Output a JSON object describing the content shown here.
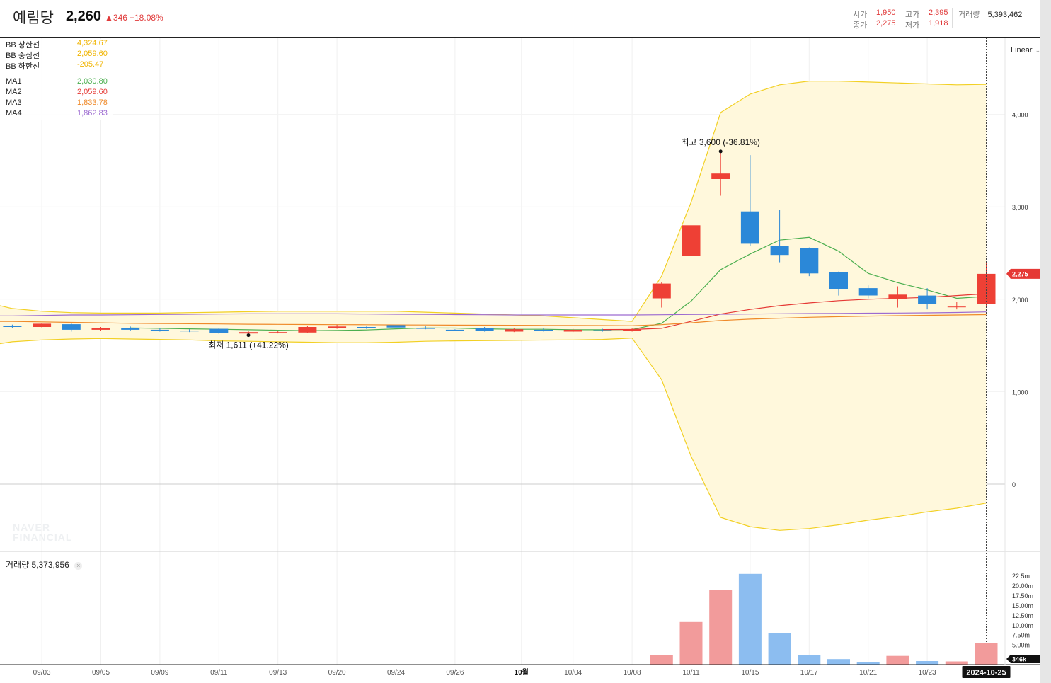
{
  "header": {
    "name": "예림당",
    "price": "2,260",
    "change": "346",
    "change_pct": "+18.08%",
    "ohlc": [
      {
        "label": "시가",
        "value": "1,950"
      },
      {
        "label": "고가",
        "value": "2,395"
      },
      {
        "label": "종가",
        "value": "2,275"
      },
      {
        "label": "저가",
        "value": "1,918"
      }
    ],
    "volume_label": "거래량",
    "volume_value": "5,393,462"
  },
  "legend": {
    "bb": [
      {
        "label": "BB 상한선",
        "value": "4,324.67",
        "color": "#f0b400"
      },
      {
        "label": "BB 중심선",
        "value": "2,059.60",
        "color": "#f0b400"
      },
      {
        "label": "BB 하한선",
        "value": "-205.47",
        "color": "#f0b400"
      }
    ],
    "ma": [
      {
        "label": "MA1",
        "value": "2,030.80",
        "color": "#4caf50"
      },
      {
        "label": "MA2",
        "value": "2,059.60",
        "color": "#e53935"
      },
      {
        "label": "MA3",
        "value": "1,833.78",
        "color": "#ef8a2a"
      },
      {
        "label": "MA4",
        "value": "1,862.83",
        "color": "#9c6ad0"
      }
    ]
  },
  "scale_mode": "Linear",
  "volume_panel": {
    "label": "거래량",
    "value": "5,373,956"
  },
  "watermark": [
    "NAVER",
    "FINANCIAL"
  ],
  "chart_data": {
    "type": "candlestick",
    "price_axis": {
      "min": -300,
      "max": 4600,
      "ticks": [
        0,
        1000,
        2000,
        3000,
        4000
      ],
      "tick_labels": [
        "0",
        "1,000",
        "2,000",
        "3,000",
        "4,000"
      ]
    },
    "volume_axis": {
      "max": 23500000,
      "ticks": [
        5000000,
        7500000,
        10000000,
        12500000,
        15000000,
        17500000,
        20000000,
        22500000
      ],
      "tick_labels": [
        "5.00m",
        "7.50m",
        "10.00m",
        "12.50m",
        "15.00m",
        "17.50m",
        "20.00m",
        "22.5m"
      ]
    },
    "x_ticks": [
      {
        "i": 1,
        "label": "09/03"
      },
      {
        "i": 3,
        "label": "09/05"
      },
      {
        "i": 5,
        "label": "09/09"
      },
      {
        "i": 7,
        "label": "09/11"
      },
      {
        "i": 9,
        "label": "09/13"
      },
      {
        "i": 11,
        "label": "09/20"
      },
      {
        "i": 13,
        "label": "09/24"
      },
      {
        "i": 15,
        "label": "09/26"
      },
      {
        "i": 17.25,
        "label": "10월",
        "bold": true
      },
      {
        "i": 19,
        "label": "10/04"
      },
      {
        "i": 21,
        "label": "10/08"
      },
      {
        "i": 23,
        "label": "10/11"
      },
      {
        "i": 25,
        "label": "10/15"
      },
      {
        "i": 27,
        "label": "10/17"
      },
      {
        "i": 29,
        "label": "10/21"
      },
      {
        "i": 31,
        "label": "10/23"
      }
    ],
    "current_date": "2024-10-25",
    "current_price_label": "2,275",
    "current_volume_label": "346k",
    "candles": [
      {
        "o": 1710,
        "h": 1725,
        "l": 1690,
        "c": 1700,
        "v": 0
      },
      {
        "o": 1700,
        "h": 1740,
        "l": 1695,
        "c": 1735,
        "v": 0
      },
      {
        "o": 1730,
        "h": 1745,
        "l": 1650,
        "c": 1670,
        "v": 0
      },
      {
        "o": 1670,
        "h": 1700,
        "l": 1660,
        "c": 1690,
        "v": 0
      },
      {
        "o": 1690,
        "h": 1705,
        "l": 1660,
        "c": 1670,
        "v": 0
      },
      {
        "o": 1670,
        "h": 1690,
        "l": 1650,
        "c": 1660,
        "v": 0
      },
      {
        "o": 1660,
        "h": 1675,
        "l": 1645,
        "c": 1655,
        "v": 0
      },
      {
        "o": 1680,
        "h": 1690,
        "l": 1625,
        "c": 1635,
        "v": 0
      },
      {
        "o": 1630,
        "h": 1660,
        "l": 1611,
        "c": 1645,
        "v": 0
      },
      {
        "o": 1640,
        "h": 1655,
        "l": 1630,
        "c": 1645,
        "v": 0
      },
      {
        "o": 1640,
        "h": 1715,
        "l": 1635,
        "c": 1700,
        "v": 0
      },
      {
        "o": 1690,
        "h": 1725,
        "l": 1680,
        "c": 1705,
        "v": 0
      },
      {
        "o": 1700,
        "h": 1705,
        "l": 1680,
        "c": 1690,
        "v": 0
      },
      {
        "o": 1720,
        "h": 1730,
        "l": 1680,
        "c": 1695,
        "v": 0
      },
      {
        "o": 1690,
        "h": 1710,
        "l": 1675,
        "c": 1680,
        "v": 0
      },
      {
        "o": 1670,
        "h": 1675,
        "l": 1655,
        "c": 1660,
        "v": 0
      },
      {
        "o": 1690,
        "h": 1700,
        "l": 1650,
        "c": 1660,
        "v": 0
      },
      {
        "o": 1650,
        "h": 1685,
        "l": 1645,
        "c": 1675,
        "v": 0
      },
      {
        "o": 1670,
        "h": 1690,
        "l": 1650,
        "c": 1660,
        "v": 0
      },
      {
        "o": 1650,
        "h": 1680,
        "l": 1645,
        "c": 1670,
        "v": 0
      },
      {
        "o": 1665,
        "h": 1680,
        "l": 1650,
        "c": 1660,
        "v": 0
      },
      {
        "o": 1660,
        "h": 1690,
        "l": 1650,
        "c": 1675,
        "v": 0
      },
      {
        "o": 2010,
        "h": 2190,
        "l": 1910,
        "c": 2170,
        "v": 2400000
      },
      {
        "o": 2470,
        "h": 2810,
        "l": 2420,
        "c": 2800,
        "v": 10800000
      },
      {
        "o": 3300,
        "h": 3600,
        "l": 3120,
        "c": 3360,
        "v": 19000000
      },
      {
        "o": 2950,
        "h": 3560,
        "l": 2580,
        "c": 2600,
        "v": 23000000
      },
      {
        "o": 2580,
        "h": 2970,
        "l": 2400,
        "c": 2480,
        "v": 8000000
      },
      {
        "o": 2550,
        "h": 2560,
        "l": 2250,
        "c": 2280,
        "v": 2400000
      },
      {
        "o": 2290,
        "h": 2300,
        "l": 2040,
        "c": 2110,
        "v": 1400000
      },
      {
        "o": 2120,
        "h": 2150,
        "l": 2010,
        "c": 2040,
        "v": 700000
      },
      {
        "o": 2000,
        "h": 2140,
        "l": 1910,
        "c": 2050,
        "v": 2200000
      },
      {
        "o": 2040,
        "h": 2120,
        "l": 1890,
        "c": 1950,
        "v": 900000
      },
      {
        "o": 1920,
        "h": 1975,
        "l": 1890,
        "c": 1920,
        "v": 800000
      },
      {
        "o": 1950,
        "h": 2395,
        "l": 1918,
        "c": 2275,
        "v": 5393462
      }
    ],
    "bb_upper": [
      1900,
      1870,
      1855,
      1850,
      1850,
      1850,
      1855,
      1860,
      1865,
      1870,
      1870,
      1870,
      1870,
      1870,
      1860,
      1850,
      1840,
      1830,
      1820,
      1800,
      1780,
      1760,
      2250,
      3050,
      4020,
      4220,
      4320,
      4360,
      4360,
      4350,
      4340,
      4330,
      4320,
      4325
    ],
    "bb_middle": [
      1720,
      1718,
      1714,
      1710,
      1707,
      1704,
      1702,
      1700,
      1698,
      1696,
      1695,
      1694,
      1693,
      1692,
      1690,
      1688,
      1686,
      1684,
      1682,
      1680,
      1678,
      1676,
      1740,
      1980,
      2320,
      2490,
      2640,
      2670,
      2520,
      2280,
      2180,
      2100,
      2020,
      2060
    ],
    "bb_lower": [
      1540,
      1560,
      1570,
      1575,
      1570,
      1565,
      1560,
      1550,
      1545,
      1540,
      1535,
      1530,
      1530,
      1535,
      1545,
      1550,
      1552,
      1555,
      1558,
      1560,
      1565,
      1580,
      1130,
      300,
      -360,
      -460,
      -500,
      -480,
      -440,
      -390,
      -350,
      -300,
      -260,
      -205
    ],
    "ma": [
      {
        "name": "MA1",
        "color": "#4caf50",
        "values": [
          null,
          null,
          null,
          null,
          1690,
          1685,
          1680,
          1675,
          1670,
          1665,
          1660,
          1662,
          1668,
          1680,
          1690,
          1688,
          1680,
          1675,
          1675,
          1670,
          1670,
          1672,
          1740,
          1980,
          2320,
          2490,
          2640,
          2670,
          2520,
          2280,
          2180,
          2100,
          2010,
          2031
        ]
      },
      {
        "name": "MA2",
        "color": "#e53935",
        "values": [
          null,
          null,
          null,
          null,
          null,
          null,
          null,
          null,
          null,
          null,
          null,
          null,
          null,
          null,
          null,
          null,
          null,
          null,
          null,
          null,
          1672,
          1673,
          1685,
          1760,
          1840,
          1890,
          1930,
          1960,
          1985,
          2000,
          2010,
          2020,
          2040,
          2060
        ]
      },
      {
        "name": "MA3",
        "color": "#ef8a2a",
        "values": [
          1760,
          1755,
          1750,
          1745,
          1740,
          1737,
          1735,
          1733,
          1730,
          1728,
          1727,
          1725,
          1724,
          1722,
          1721,
          1720,
          1719,
          1718,
          1717,
          1716,
          1715,
          1714,
          1725,
          1745,
          1770,
          1785,
          1795,
          1805,
          1812,
          1818,
          1822,
          1826,
          1830,
          1834
        ]
      },
      {
        "name": "MA4",
        "color": "#9c6ad0",
        "values": [
          1820,
          1825,
          1830,
          1830,
          1832,
          1835,
          1838,
          1840,
          1842,
          1843,
          1843,
          1842,
          1840,
          1838,
          1836,
          1834,
          1832,
          1830,
          1830,
          1830,
          1830,
          1830,
          1832,
          1835,
          1838,
          1840,
          1843,
          1845,
          1847,
          1849,
          1851,
          1853,
          1857,
          1863
        ]
      }
    ],
    "annotations": [
      {
        "type": "high",
        "i": 24,
        "value": 3600,
        "label": "최고 3,600 (-36.81%)"
      },
      {
        "type": "low",
        "i": 8,
        "value": 1611,
        "label": "최저 1,611 (+41.22%)"
      }
    ]
  }
}
